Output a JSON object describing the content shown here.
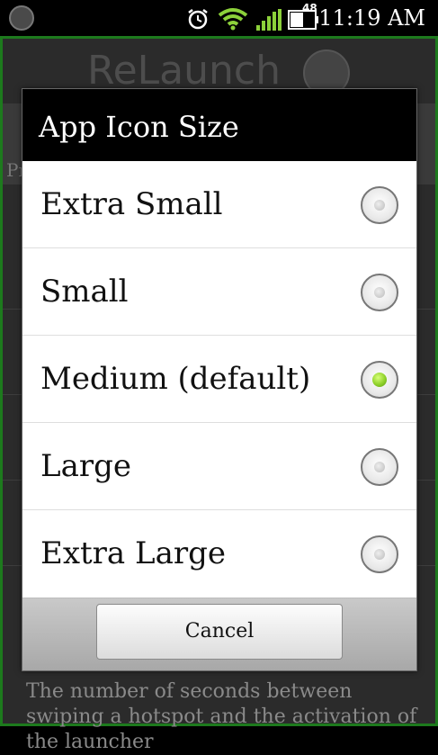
{
  "status_bar": {
    "battery_level": "48",
    "time": "11:19 AM",
    "icons": [
      "launcher-icon",
      "alarm-icon",
      "wifi-icon",
      "signal-icon",
      "battery-icon"
    ]
  },
  "background_app": {
    "app_name": "ReLaunch",
    "section_label": "Pr",
    "description": "The number of seconds between swiping a hotspot and the activation of the launcher"
  },
  "dialog": {
    "title": "App Icon Size",
    "options": [
      {
        "label": "Extra Small",
        "selected": false
      },
      {
        "label": "Small",
        "selected": false
      },
      {
        "label": "Medium (default)",
        "selected": true
      },
      {
        "label": "Large",
        "selected": false
      },
      {
        "label": "Extra Large",
        "selected": false
      }
    ],
    "cancel_label": "Cancel"
  },
  "colors": {
    "radio_selected": "#8fd12a",
    "title_bar": "#000000",
    "frame_border": "#1d7a1d"
  }
}
